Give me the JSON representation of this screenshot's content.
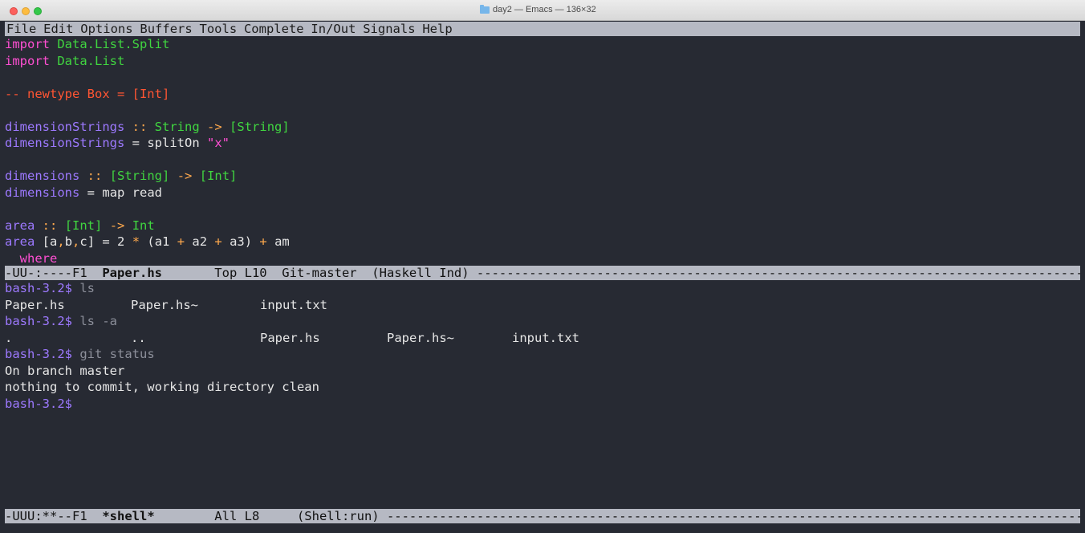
{
  "window": {
    "title": "day2 — Emacs — 136×32"
  },
  "menubar": [
    "File",
    "Edit",
    "Options",
    "Buffers",
    "Tools",
    "Complete",
    "In/Out",
    "Signals",
    "Help"
  ],
  "editor": {
    "import1_kw": "import",
    "import1_mod": "Data.List.Split",
    "import2_kw": "import",
    "import2_mod": "Data.List",
    "comment": "-- newtype Box = [Int]",
    "ds_sig_name": "dimensionStrings",
    "ds_sig_op": "::",
    "ds_sig_t1": "String",
    "ds_sig_arrow": "->",
    "ds_sig_t2": "[String]",
    "ds_def_name": "dimensionStrings",
    "ds_def_op": "=",
    "ds_def_body": "splitOn",
    "ds_def_str": "\"x\"",
    "dim_sig_name": "dimensions",
    "dim_sig_op": "::",
    "dim_sig_t1": "[String]",
    "dim_sig_arrow": "->",
    "dim_sig_t2": "[Int]",
    "dim_def_name": "dimensions",
    "dim_def_op": "=",
    "dim_def_body": "map read",
    "area_sig_name": "area",
    "area_sig_op": "::",
    "area_sig_t1": "[Int]",
    "area_sig_arrow": "->",
    "area_sig_t2": "Int",
    "area_def_name": "area",
    "where_kw": "where"
  },
  "editor_modeline": {
    "status": "-UU-:----F1  ",
    "buffer": "Paper.hs",
    "rest": "       Top L10  Git-master  (Haskell Ind) ----------------------------------------------------------------------------------------------------"
  },
  "shell": {
    "prompt": "bash-3.2$",
    "cmd1": "ls",
    "ls_out": [
      "Paper.hs",
      "Paper.hs~",
      "input.txt"
    ],
    "cmd2": "ls -a",
    "lsa_out": [
      ".",
      "..",
      "Paper.hs",
      "Paper.hs~",
      "input.txt"
    ],
    "cmd3": "git status",
    "out1": "On branch master",
    "out2": "nothing to commit, working directory clean"
  },
  "shell_modeline": {
    "status": "-UUU:**--F1  ",
    "buffer": "*shell*",
    "rest": "        All L8     (Shell:run) ------------------------------------------------------------------------------------------------------------"
  },
  "colors": {
    "background": "#272a33",
    "modeline": "#b6b9c3",
    "keyword": "#ff4fd3",
    "type": "#40d540",
    "function": "#9d79ff",
    "operator": "#ffa94d",
    "comment": "#ff5533"
  }
}
